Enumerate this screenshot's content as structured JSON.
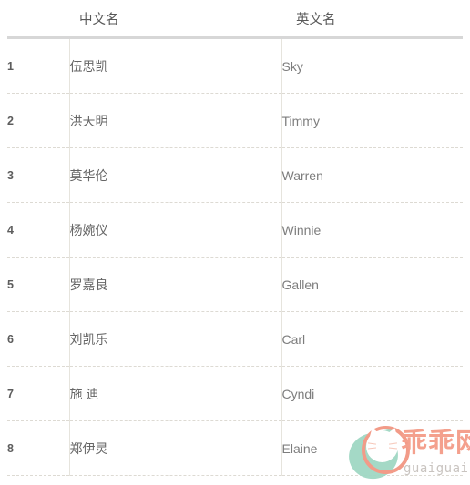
{
  "table": {
    "columns": [
      {
        "key": "index",
        "label": ""
      },
      {
        "key": "chinese_name",
        "label": "中文名"
      },
      {
        "key": "english_name",
        "label": "英文名"
      }
    ],
    "rows": [
      {
        "index": "1",
        "chinese_name": "伍思凯",
        "english_name": "Sky"
      },
      {
        "index": "2",
        "chinese_name": "洪天明",
        "english_name": "Timmy"
      },
      {
        "index": "3",
        "chinese_name": "莫华伦",
        "english_name": "Warren"
      },
      {
        "index": "4",
        "chinese_name": "杨婉仪",
        "english_name": "Winnie"
      },
      {
        "index": "5",
        "chinese_name": "罗嘉良",
        "english_name": "Gallen"
      },
      {
        "index": "6",
        "chinese_name": "刘凯乐",
        "english_name": "Carl"
      },
      {
        "index": "7",
        "chinese_name": "施 迪",
        "english_name": "Cyndi"
      },
      {
        "index": "8",
        "chinese_name": "郑伊灵",
        "english_name": "Elaine"
      }
    ]
  },
  "watermark": {
    "brand": "乖乖网",
    "domain": "guaiguai.com",
    "brand_color": "#f4a08d",
    "leaf_color": "#9fd7c3",
    "domain_color": "#c9c4c0"
  },
  "colors": {
    "header_text": "#595959",
    "header_rule": "#d7d7d7",
    "row_divider": "#dddad3",
    "column_divider": "#e6e4dd",
    "index_text": "#5d5d5d",
    "chinese_text": "#666666",
    "english_text": "#7d7d7d",
    "background": "#ffffff"
  }
}
